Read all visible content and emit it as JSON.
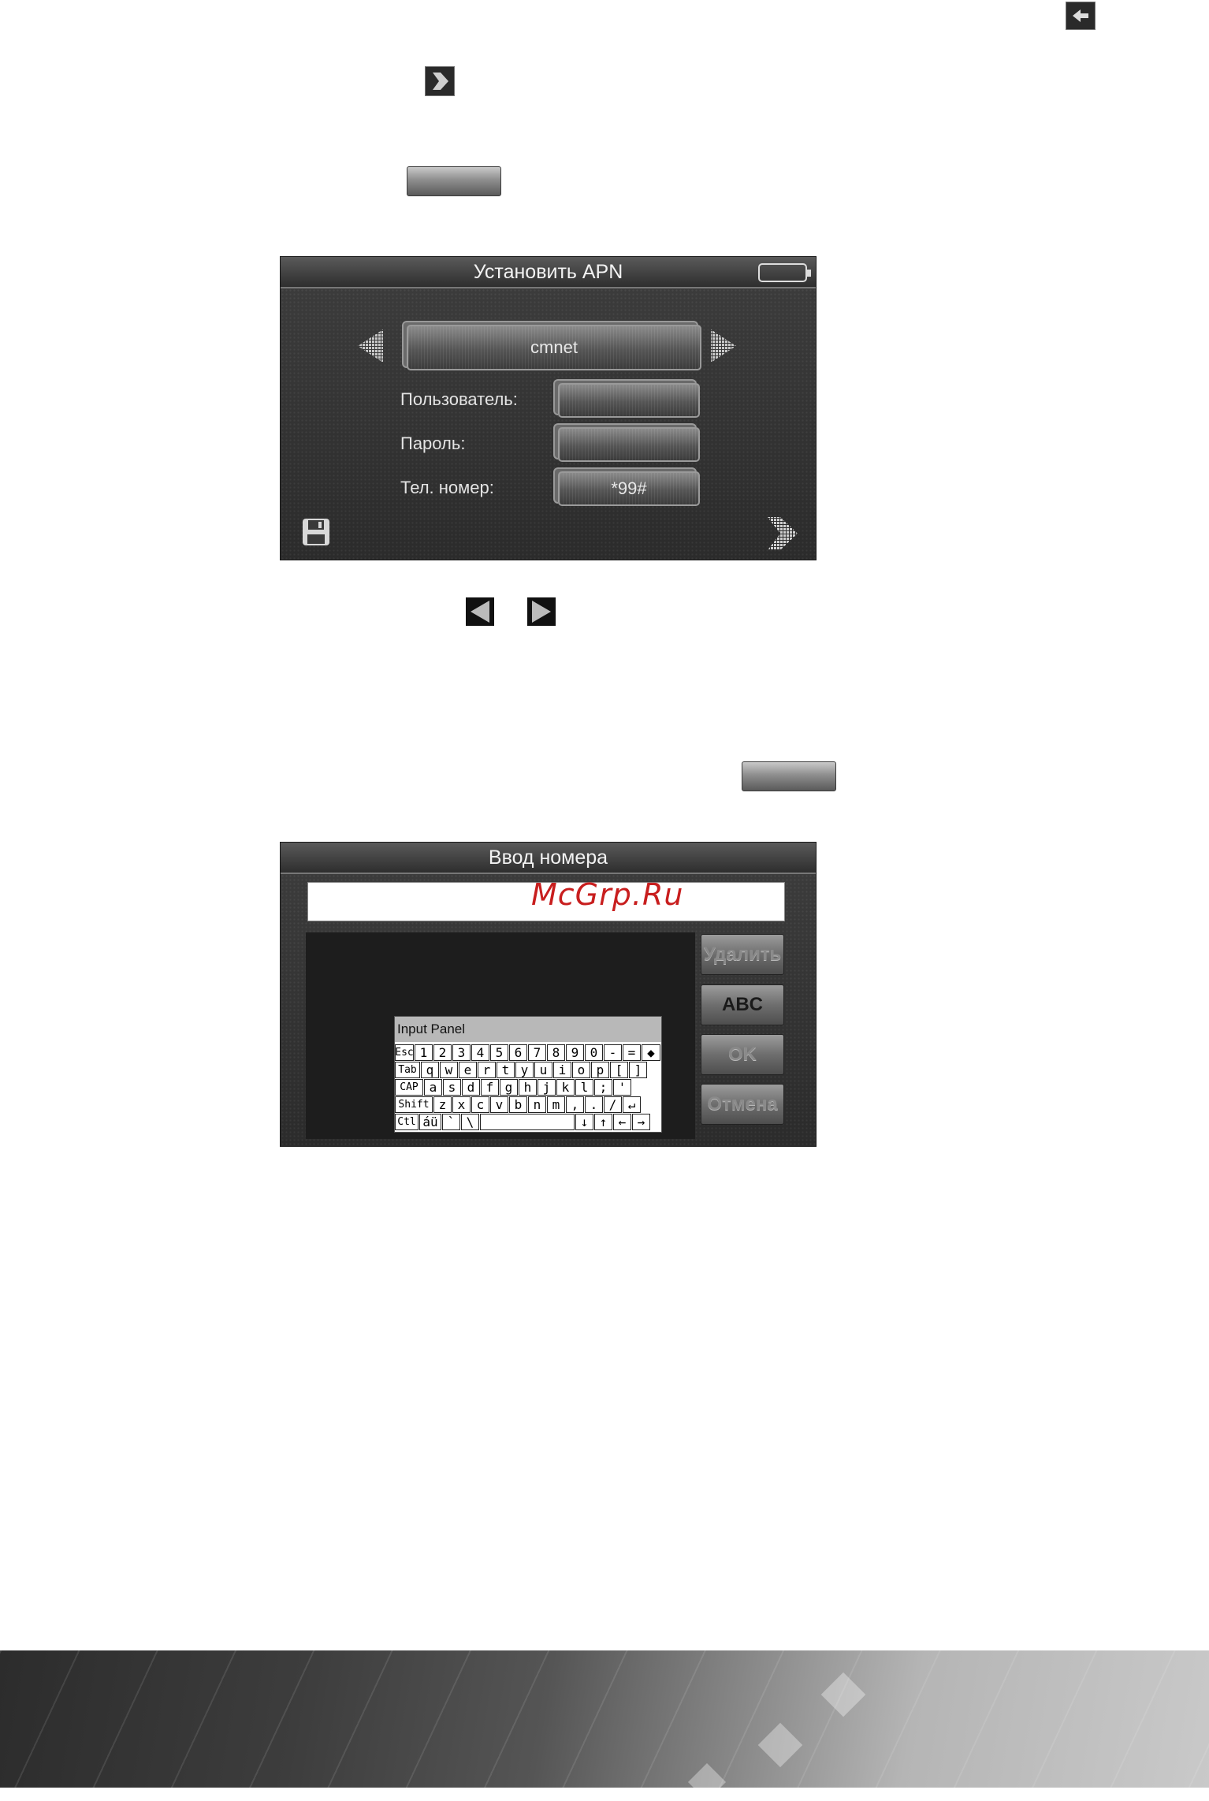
{
  "apn_screen": {
    "title": "Установить APN",
    "apn_value": "cmnet",
    "user_label": "Пользователь:",
    "user_value": "",
    "password_label": "Пароль:",
    "password_value": "",
    "phone_label": "Тел. номер:",
    "phone_value": "*99#"
  },
  "number_screen": {
    "title": "Ввод номера",
    "input_value": "",
    "buttons": {
      "delete": "Удалить",
      "abc": "ABC",
      "ok": "OK",
      "cancel": "Отмена"
    },
    "keyboard": {
      "title": "Input Panel",
      "rows": [
        [
          "Esc",
          "1",
          "2",
          "3",
          "4",
          "5",
          "6",
          "7",
          "8",
          "9",
          "0",
          "-",
          "=",
          "◆"
        ],
        [
          "Tab",
          "q",
          "w",
          "e",
          "r",
          "t",
          "y",
          "u",
          "i",
          "o",
          "p",
          "[",
          "]"
        ],
        [
          "CAP",
          "a",
          "s",
          "d",
          "f",
          "g",
          "h",
          "j",
          "k",
          "l",
          ";",
          "'"
        ],
        [
          "Shift",
          "z",
          "x",
          "c",
          "v",
          "b",
          "n",
          "m",
          ",",
          ".",
          "/",
          "↵"
        ],
        [
          "Ctl",
          "áü",
          "`",
          "\\",
          " ",
          "↓",
          "↑",
          "←",
          "→"
        ]
      ]
    }
  },
  "watermark": "McGrp.Ru"
}
